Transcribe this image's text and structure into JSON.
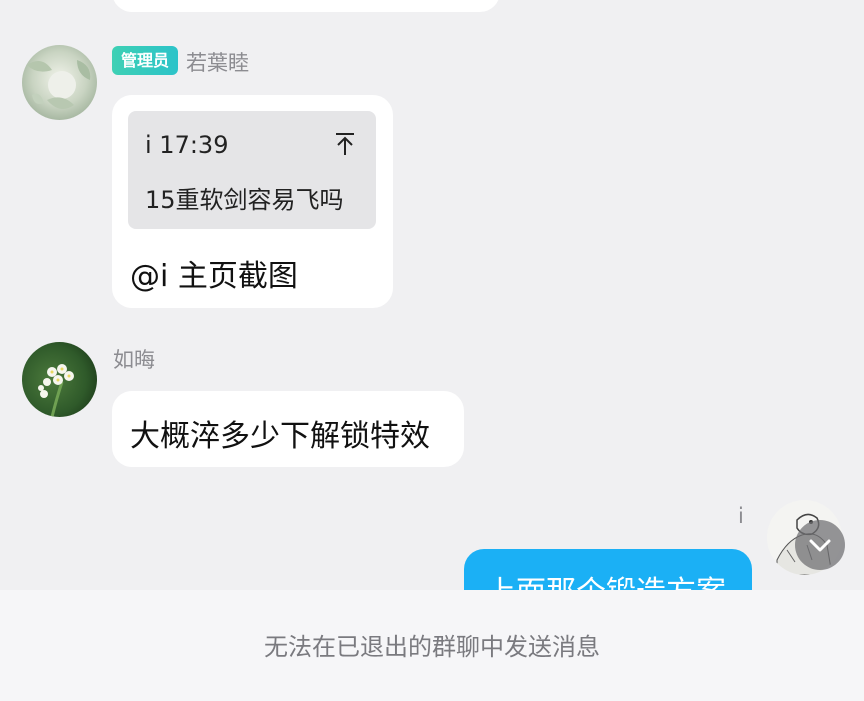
{
  "messages": [
    {
      "sender": "若葉睦",
      "badge": "管理员",
      "quote": {
        "header": "i 17:39",
        "text": "15重软剑容易飞吗"
      },
      "text": "@i 主页截图"
    },
    {
      "sender": "如晦",
      "text": "大概淬多少下解锁特效"
    },
    {
      "sender": "i",
      "text": "上面那个锻造方案",
      "self": true
    }
  ],
  "footer": {
    "notice": "无法在已退出的群聊中发送消息"
  },
  "colors": {
    "background": "#f0f0f2",
    "bubble": "#ffffff",
    "self_bubble": "#1bb0f5",
    "admin_badge": "#3ed0b4",
    "name": "#8c8c91"
  },
  "icons": {
    "quote_jump": "arrow-up-to-top-icon",
    "scroll_down": "chevron-down-icon"
  }
}
